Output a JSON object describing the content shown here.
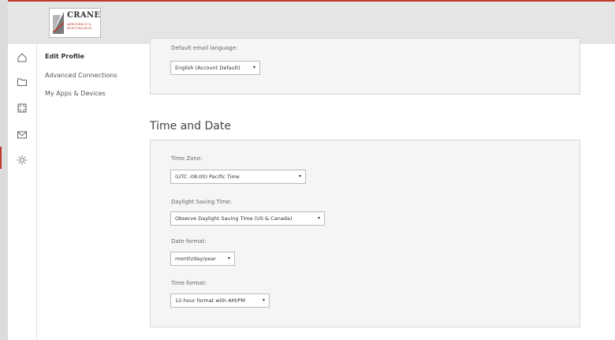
{
  "brand": {
    "name": "CRANE",
    "sub_line1": "AEROSPACE &",
    "sub_line2": "ELECTRONICS",
    "accent": "#c0392b"
  },
  "rail": {
    "icons": [
      "home-icon",
      "folder-icon",
      "frame-icon",
      "mail-icon",
      "gear-icon"
    ],
    "active": "gear-icon"
  },
  "subnav": {
    "items": [
      {
        "label": "Edit Profile",
        "active": true
      },
      {
        "label": "Advanced Connections",
        "active": false
      },
      {
        "label": "My Apps & Devices",
        "active": false
      }
    ]
  },
  "email": {
    "label": "Default email language:",
    "value": "English (Account Default)",
    "caret": "▾"
  },
  "time_date": {
    "title": "Time and Date",
    "time_zone": {
      "label": "Time Zone:",
      "value": "(UTC -08:00) Pacific Time",
      "caret": "▾"
    },
    "dst": {
      "label": "Daylight Saving Time:",
      "value": "Observe Daylight Saving Time (US & Canada)",
      "caret": "▾"
    },
    "date_format": {
      "label": "Date format:",
      "value": "month/day/year",
      "caret": "▾"
    },
    "time_format": {
      "label": "Time format:",
      "value": "12-hour format with AM/PM",
      "caret": "▾"
    }
  }
}
